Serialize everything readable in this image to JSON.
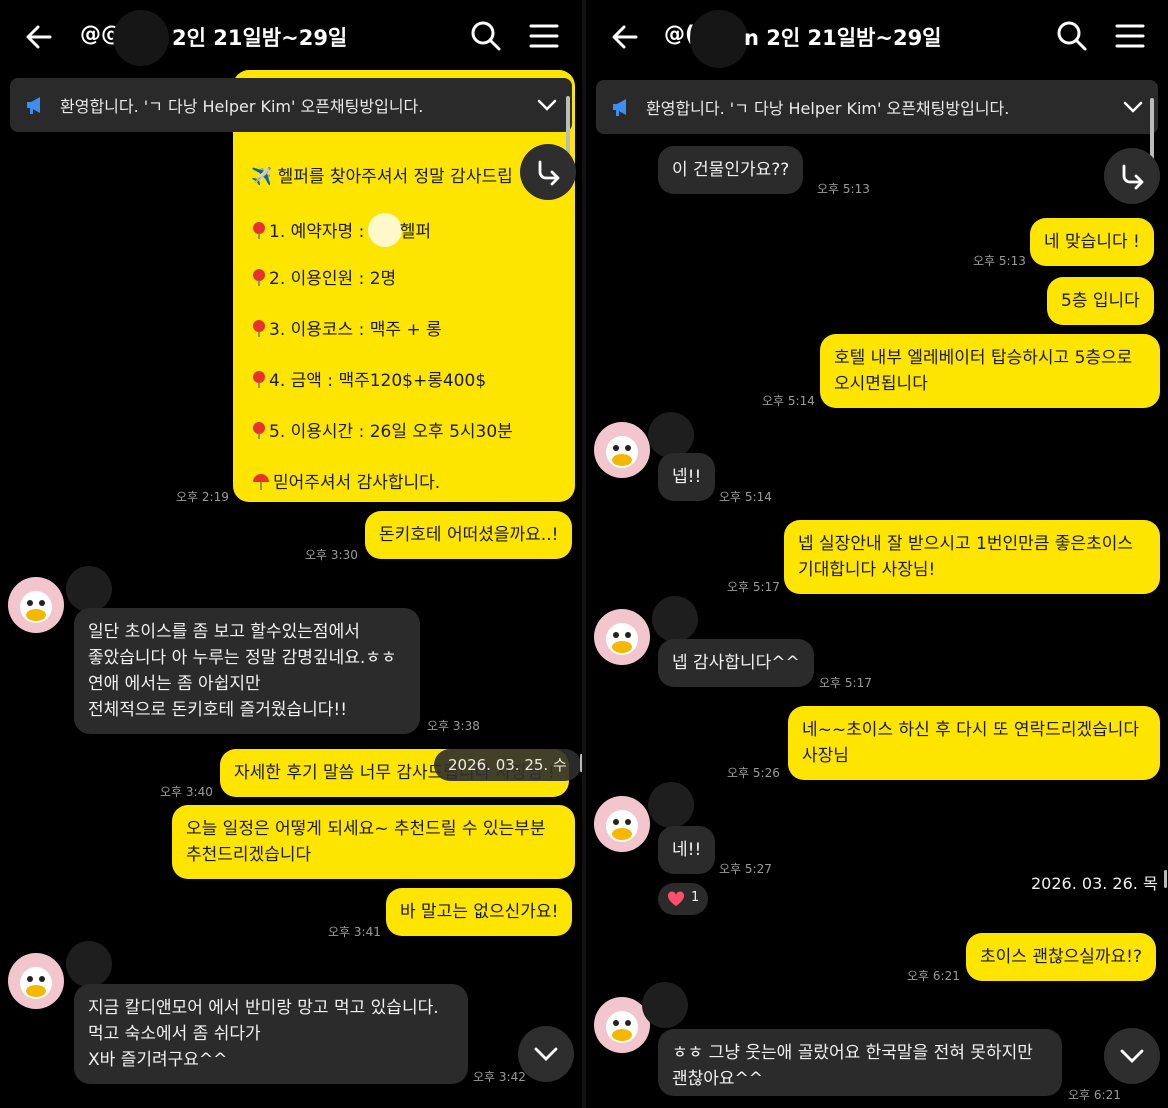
{
  "left": {
    "header": {
      "title_prefix": "@@",
      "title_main": "2인 21일밤~29일"
    },
    "notice": {
      "text": "환영합니다. 'ㄱ 다낭 Helper Kim' 오픈채팅방입니다."
    },
    "reservation": {
      "line0": "✈️ 헬퍼를 찾아주셔서 정말 감사드립",
      "line1_a": "1. 예약자명 :",
      "line1_b": "헬퍼",
      "line2": "2. 이용인원 :  2명",
      "line3": "3. 이용코스 :    맥주 + 롱",
      "line4": "4. 금액 :  맥주120$+롱400$",
      "line5": "5. 이용시간 : 26일 오후 5시30분",
      "line6": "믿어주셔서 감사합니다.",
      "time": "오후 2:19"
    },
    "messages": {
      "m1": {
        "text": "돈키호테 어떠셨을까요..!",
        "time": "오후 3:30"
      },
      "m2": {
        "line1": "일단 초이스를 좀 보고 할수있는점에서",
        "line2": "좋았습니다 아 누루는 정말 감명깊네요.ㅎㅎ",
        "line3": "연애 에서는 좀 아쉽지만",
        "line4": "전체적으로 돈키호테 즐거웠습니다!!",
        "time": "오후 3:38"
      },
      "m3": {
        "text": "자세한 후기 말씀 너무 감사드립니다 사장님 !",
        "time": "오후 3:40"
      },
      "m4": {
        "line1": "오늘 일정은 어떻게 되세요~  추천드릴 수 있는부분",
        "line2": "추천드리겠습니다"
      },
      "m5": {
        "text": "바 말고는 없으신가요!",
        "time": "오후 3:41"
      },
      "m6": {
        "line1": "지금 칼디앤모어 에서 반미랑 망고 먹고 있습니다.",
        "line2": "먹고 숙소에서 좀 쉬다가",
        "line3": "X바 즐기려구요^^",
        "time": "오후 3:42"
      }
    },
    "date_pill": "2026. 03. 25. 수"
  },
  "right": {
    "header": {
      "title_prefix": "@(",
      "title_main": "n 2인 21일밤~29일"
    },
    "notice": {
      "text": "환영합니다. 'ㄱ 다낭 Helper Kim' 오픈채팅방입니다."
    },
    "messages": {
      "r1": {
        "text": "이 건물인가요??",
        "time": "오후 5:13"
      },
      "r2": {
        "text": "네 맞습니다 !",
        "time": "오후 5:13"
      },
      "r3": {
        "text": "5층 입니다"
      },
      "r4": {
        "line1": "호텔 내부 엘레베이터 탑승하시고 5층으로",
        "line2": "오시면됩니다",
        "time": "오후 5:14"
      },
      "r5": {
        "text": "넵!!",
        "time": "오후 5:14"
      },
      "r6": {
        "line1": "넵 실장안내 잘 받으시고 1번인만큼 좋은초이스",
        "line2": "기대합니다 사장님!",
        "time": "오후 5:17"
      },
      "r7": {
        "text": "넵 감사합니다^^",
        "time": "오후 5:17"
      },
      "r8": {
        "line1": "네~~초이스 하신 후 다시 또 연락드리겠습니다",
        "line2": "사장님",
        "time": "오후 5:26"
      },
      "r9": {
        "text": "네!!",
        "time": "오후 5:27"
      },
      "r9_reaction": "1",
      "r10": {
        "text": "초이스 괜찮으실까요!?",
        "time": "오후 6:21"
      },
      "r11": {
        "line1": "ㅎㅎ 그냥 웃는애 골랐어요 한국말을 전혀 못하지만",
        "line2": "괜찮아요^^",
        "time": "오후 6:21"
      }
    },
    "date_text": "2026. 03. 26. 목"
  },
  "colors": {
    "yellow": "#fee500",
    "dark_bubble": "#2b2b2b",
    "notice_bg": "#2a2a2a",
    "notice_icon": "#3d8ef0",
    "heart": "#ff4f6d"
  },
  "icons": [
    "back-arrow-icon",
    "search-icon",
    "hamburger-menu-icon",
    "megaphone-icon",
    "chevron-down-icon",
    "reply-arrow-icon",
    "pin-icon",
    "airplane-icon",
    "heart-icon"
  ]
}
